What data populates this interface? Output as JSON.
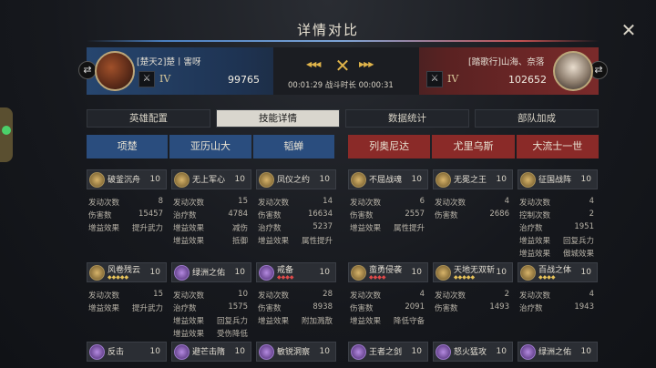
{
  "title": "详情对比",
  "left": {
    "name": "[楚天2]楚丨害呀",
    "level": "IV",
    "power": "99765"
  },
  "right": {
    "name": "[踏歌行]山海、奈落",
    "level": "IV",
    "power": "102652"
  },
  "timer": "00:01:29 战斗时长 00:00:31",
  "tabs": [
    "英雄配置",
    "技能详情",
    "数据统计",
    "部队加成"
  ],
  "heroes_left": [
    "项楚",
    "亚历山大",
    "韬蝉"
  ],
  "heroes_right": [
    "列奥尼达",
    "尤里乌斯",
    "大流士一世"
  ],
  "colors": {
    "blue": "#2a4d7e",
    "red": "#8a2a28",
    "gold": "#e0b44a"
  },
  "icons": {
    "close": "close-icon",
    "swap": "swap-icon",
    "sword": "sword-icon",
    "vs": "crossed-swords-icon"
  },
  "cards": [
    {
      "name": "破釜沉舟",
      "lv": "10",
      "stars": "",
      "stats": [
        [
          "发动次数",
          "8"
        ],
        [
          "伤害数",
          "15457"
        ],
        [
          "增益效果",
          "提升武力"
        ]
      ]
    },
    {
      "name": "无上军心",
      "lv": "10",
      "stars": "",
      "stats": [
        [
          "发动次数",
          "15"
        ],
        [
          "治疗数",
          "4784"
        ],
        [
          "增益效果",
          "减伤"
        ],
        [
          "增益效果",
          "抵御"
        ]
      ]
    },
    {
      "name": "凤仪之约",
      "lv": "10",
      "stars": "",
      "stats": [
        [
          "发动次数",
          "14"
        ],
        [
          "伤害数",
          "16634"
        ],
        [
          "治疗数",
          "5237"
        ],
        [
          "增益效果",
          "属性提升"
        ]
      ]
    },
    {
      "name": "不屈战魂",
      "lv": "10",
      "stars": "",
      "stats": [
        [
          "发动次数",
          "6"
        ],
        [
          "伤害数",
          "2557"
        ],
        [
          "增益效果",
          "属性提升"
        ]
      ]
    },
    {
      "name": "无冕之王",
      "lv": "10",
      "stars": "",
      "stats": [
        [
          "发动次数",
          "4"
        ],
        [
          "伤害数",
          "2686"
        ]
      ]
    },
    {
      "name": "征国战阵",
      "lv": "10",
      "stars": "",
      "stats": [
        [
          "发动次数",
          "4"
        ],
        [
          "控制次数",
          "2"
        ],
        [
          "治疗数",
          "1951"
        ],
        [
          "增益效果",
          "回复兵力"
        ],
        [
          "增益效果",
          "傲城效果"
        ]
      ]
    },
    {
      "name": "风卷残云",
      "lv": "10",
      "stars": "◆◆◆◆◆",
      "stats": [
        [
          "发动次数",
          "15"
        ],
        [
          "增益效果",
          "提升武力"
        ]
      ]
    },
    {
      "name": "绿洲之佑",
      "lv": "10",
      "stars": "",
      "stats": [
        [
          "发动次数",
          "10"
        ],
        [
          "治疗数",
          "1575"
        ],
        [
          "增益效果",
          "回复兵力"
        ],
        [
          "增益效果",
          "受伤降低"
        ]
      ]
    },
    {
      "name": "戒备",
      "lv": "10",
      "stars": "◆◆◆◆",
      "stats": [
        [
          "发动次数",
          "28"
        ],
        [
          "伤害数",
          "8938"
        ],
        [
          "增益效果",
          "附加溅散"
        ]
      ]
    },
    {
      "name": "蛮勇侵袭",
      "lv": "10",
      "stars": "◆◆◆◆",
      "stats": [
        [
          "发动次数",
          "4"
        ],
        [
          "伤害数",
          "2091"
        ],
        [
          "增益效果",
          "降低守备"
        ]
      ]
    },
    {
      "name": "天地无双斩",
      "lv": "10",
      "stars": "◆◆◆◆◆",
      "stats": [
        [
          "发动次数",
          "2"
        ],
        [
          "伤害数",
          "1493"
        ]
      ]
    },
    {
      "name": "百战之体",
      "lv": "10",
      "stars": "◆◆◆◆",
      "stats": [
        [
          "发动次数",
          "4"
        ],
        [
          "治疗数",
          "1943"
        ]
      ]
    },
    {
      "name": "反击",
      "lv": "10",
      "stars": "",
      "stats": []
    },
    {
      "name": "避芒击隋",
      "lv": "10",
      "stars": "",
      "stats": []
    },
    {
      "name": "敏锐洞察",
      "lv": "10",
      "stars": "",
      "stats": []
    },
    {
      "name": "王者之剑",
      "lv": "10",
      "stars": "",
      "stats": []
    },
    {
      "name": "怒火猛攻",
      "lv": "10",
      "stars": "",
      "stats": []
    },
    {
      "name": "绿洲之佑",
      "lv": "10",
      "stars": "",
      "stats": []
    }
  ]
}
